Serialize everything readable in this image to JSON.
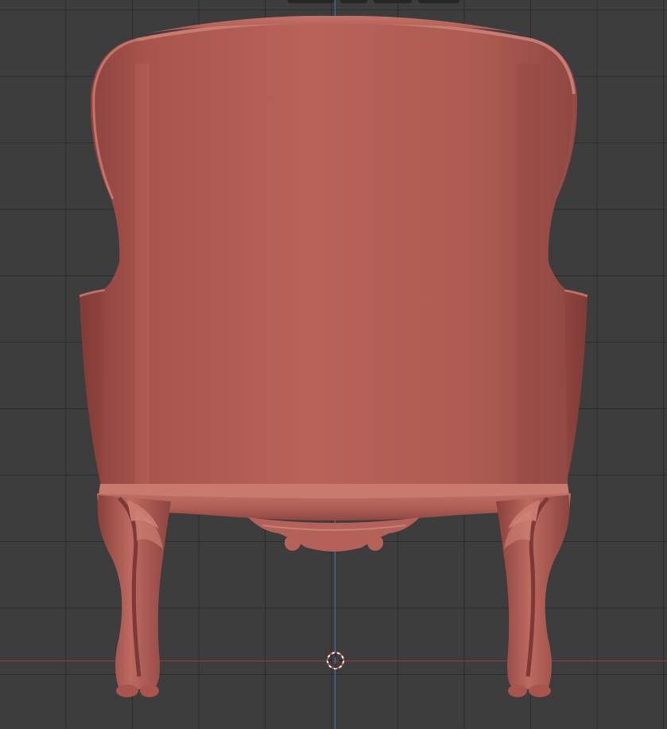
{
  "viewport": {
    "background_color": "#3d3d3d",
    "grid_color": "#2a2a2a",
    "x_axis_color": "#9b3b48",
    "z_axis_color": "#3e78b4"
  },
  "header": {
    "tabs": [
      {
        "icon": "viewport-header-tab"
      },
      {
        "icon": "viewport-header-tab"
      },
      {
        "icon": "viewport-header-tab"
      },
      {
        "icon": "viewport-header-tab"
      }
    ]
  },
  "model": {
    "name": "",
    "material_color": "#b35b52"
  },
  "cursor": {
    "icon": "3d-cursor-icon"
  }
}
